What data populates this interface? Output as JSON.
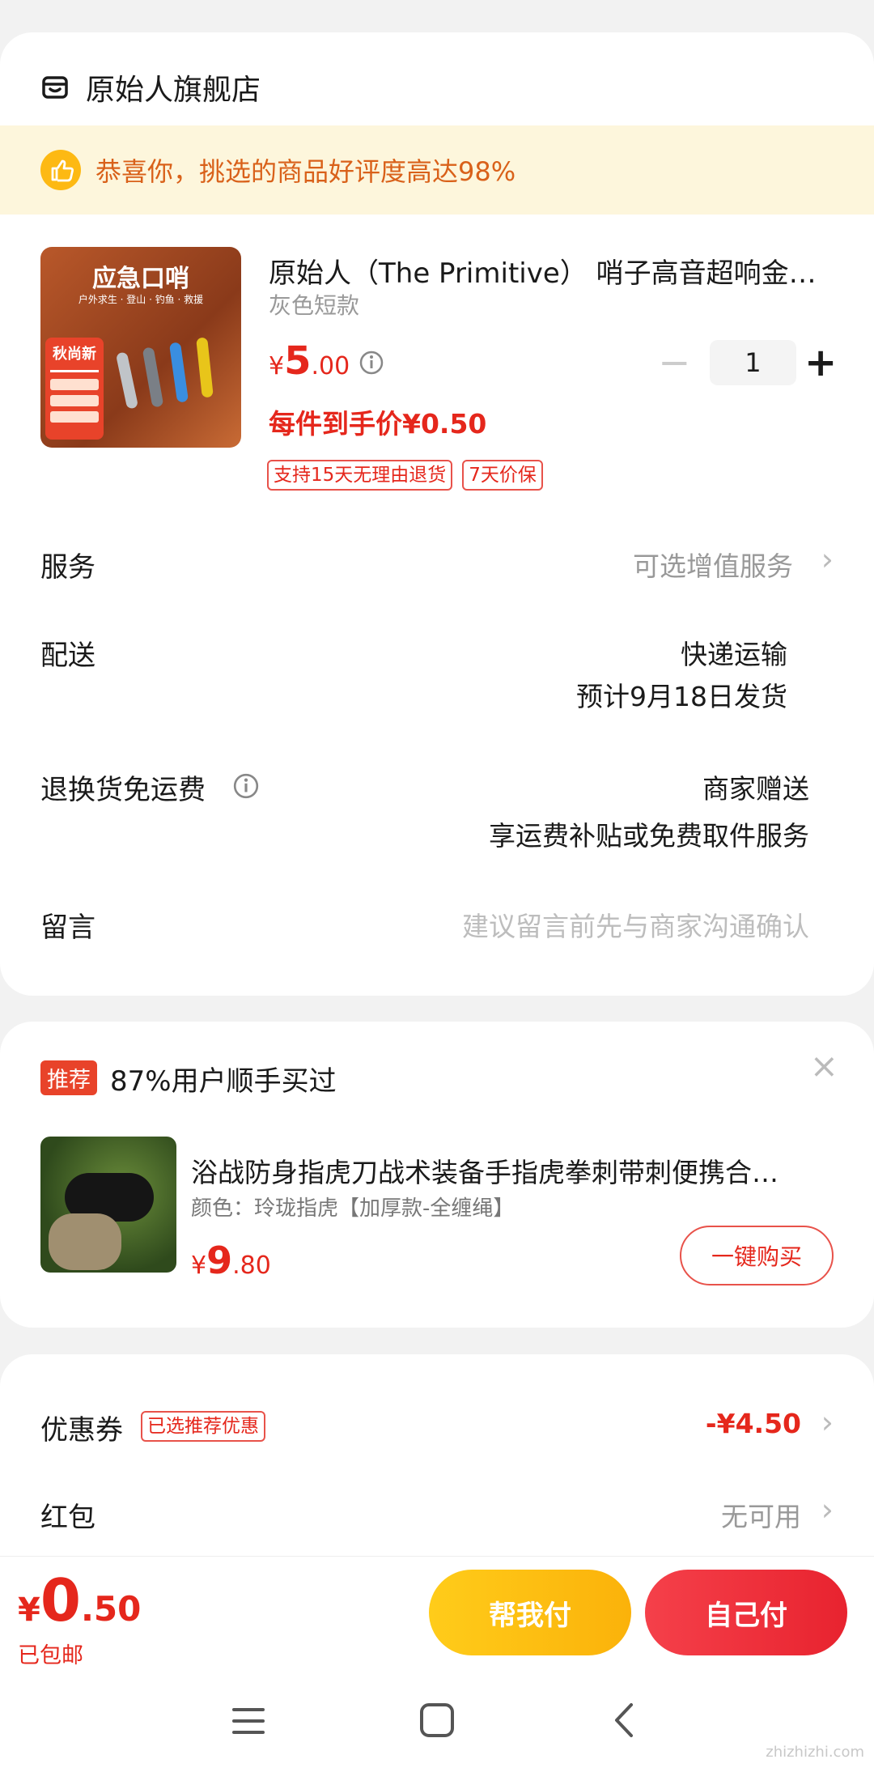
{
  "shop": {
    "name": "原始人旗舰店",
    "icon": "store-icon"
  },
  "notice": {
    "text": "恭喜你，挑选的商品好评度高达98%",
    "icon": "thumbs-up-icon"
  },
  "product": {
    "image_title": "应急口哨",
    "image_subtitle": "户外求生 · 登山 · 钓鱼 · 救援",
    "image_badge": "秋尚新",
    "title": "原始人（The Primitive） 哨子高音超响金…",
    "variant": "灰色短款",
    "currency": "¥",
    "price_int": "5",
    "price_dec": ".00",
    "final_price": "每件到手价¥0.50",
    "quantity": "1",
    "minus": "−",
    "plus": "+",
    "tags": [
      "支持15天无理由退货",
      "7天价保"
    ]
  },
  "rows": {
    "service_label": "服务",
    "service_value": "可选增值服务",
    "delivery_label": "配送",
    "delivery_value": "快递运输",
    "delivery_eta": "预计9月18日发货",
    "return_label": "退换货免运费",
    "return_value": "商家赠送",
    "return_desc": "享运费补贴或免费取件服务",
    "message_label": "留言",
    "message_placeholder": "建议留言前先与商家沟通确认"
  },
  "recommend": {
    "badge": "推荐",
    "title": "87%用户顺手买过",
    "close": "×",
    "item_title": "浴战防身指虎刀战术装备手指虎拳刺带刺便携合…",
    "item_variant": "颜色：玲珑指虎【加厚款-全缠绳】",
    "currency": "¥",
    "price_int": "9",
    "price_dec": ".80",
    "buy_label": "一键购买"
  },
  "discounts": {
    "coupon_label": "优惠券",
    "coupon_tag": "已选推荐优惠",
    "coupon_value": "-¥4.50",
    "redpacket_label": "红包",
    "redpacket_value": "无可用"
  },
  "footer": {
    "currency": "¥",
    "total_int": "0",
    "total_dec": ".50",
    "shipping": "已包邮",
    "help_pay": "帮我付",
    "self_pay": "自己付"
  },
  "navbar": {
    "menu": "menu-icon",
    "home": "home-icon",
    "back": "back-icon"
  },
  "watermark": "zhizhizhi.com",
  "colors": {
    "accent": "#e5271c",
    "yellow": "#fdb913",
    "notice_bg": "#fdf6dc"
  }
}
